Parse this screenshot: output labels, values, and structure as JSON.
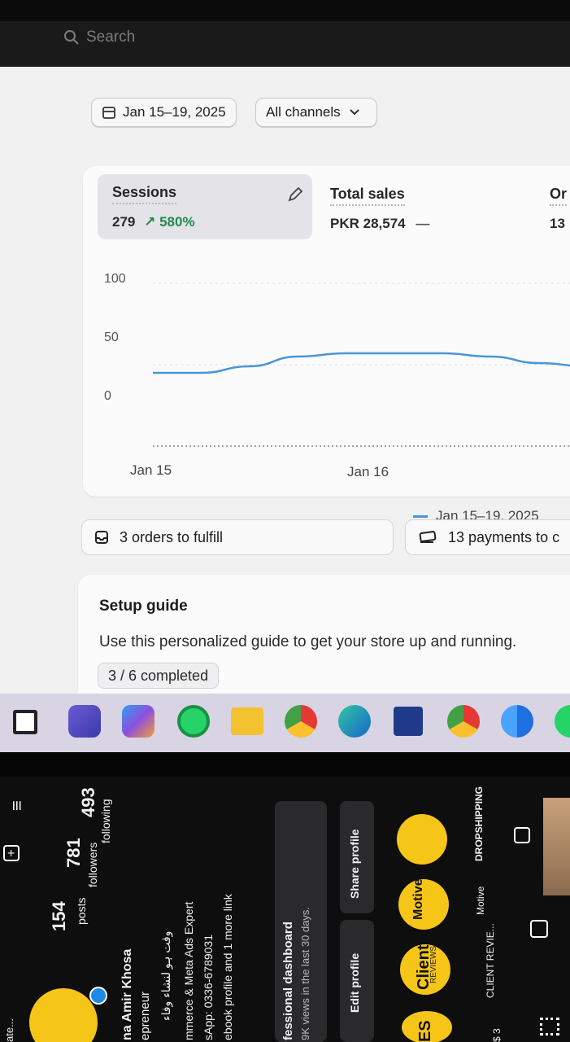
{
  "search": {
    "placeholder": "Search"
  },
  "filters": {
    "date_range": "Jan 15–19, 2025",
    "channels": "All channels"
  },
  "metrics": [
    {
      "name": "Sessions",
      "value": "279",
      "delta": "580%"
    },
    {
      "name": "Total sales",
      "value": "PKR 28,574",
      "delta": "—"
    },
    {
      "name": "Or",
      "value": "13"
    }
  ],
  "chart_data": {
    "type": "line",
    "x": [
      "Jan 15",
      "Jan 16"
    ],
    "y_ticks": [
      "100",
      "50",
      "0"
    ],
    "ylim": [
      0,
      100
    ],
    "series": [
      {
        "name": "Jan 15–19, 2025",
        "values": [
          45,
          45,
          49,
          55,
          57,
          57,
          57,
          55,
          51,
          49
        ],
        "color": "#4b95d6"
      }
    ],
    "legend": "bottom-right",
    "grid": true
  },
  "tasks": {
    "orders": "3 orders to fulfill",
    "payments": "13 payments to c"
  },
  "setup_guide": {
    "title": "Setup guide",
    "description": "Use this personalized guide to get your store up and running.",
    "progress": "3 / 6 completed"
  },
  "taskbar": [
    "start",
    "teams",
    "copilot",
    "whatsapp",
    "file-explorer",
    "chrome",
    "edge",
    "store",
    "chrome-profile",
    "chrome-alt",
    "whatsapp-partial"
  ],
  "phone": {
    "stats": [
      {
        "num": "154",
        "label": "posts"
      },
      {
        "num": "781",
        "label": "followers"
      },
      {
        "num": "493",
        "label": "following"
      }
    ],
    "bio": [
      "na Amir Khosa",
      "epreneur",
      "وقت ہو لنشاء وفاء",
      "mmerce & Meta Ads Expert",
      "sApp: 0336-6789031",
      "ebook profile and 1 more link"
    ],
    "dashboard": [
      "fessional dashboard",
      "9K views in the last 30 days."
    ],
    "buttons": [
      "Edit profile",
      "Share profile"
    ],
    "highlights": [
      "ES",
      "CLIENT REVIE...",
      "Motive",
      "DROPSHIPPING",
      "$ 3"
    ],
    "highlight_covers": [
      "Client",
      "REVIEWS",
      "Motive"
    ],
    "partial": "ate..."
  }
}
